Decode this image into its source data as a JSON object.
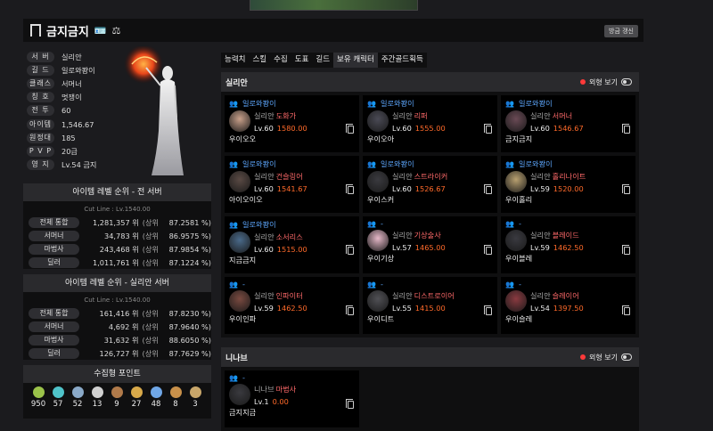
{
  "header": {
    "name": "금지금지",
    "refresh_label": "방금 갱신"
  },
  "profile": {
    "rows": [
      {
        "label": "서 버",
        "value": "실리안"
      },
      {
        "label": "길 드",
        "value": "일로와봥이"
      },
      {
        "label": "클래스",
        "value": "서머너"
      },
      {
        "label": "칭 호",
        "value": "멋쟁이"
      },
      {
        "label": "전 투",
        "value": "60"
      },
      {
        "label": "아이템",
        "value": "1,546.67"
      },
      {
        "label": "원정대",
        "value": "185"
      },
      {
        "label": "P V P",
        "value": "20급"
      },
      {
        "label": "영 지",
        "value": "Lv.54 금지"
      }
    ]
  },
  "rank_all": {
    "title": "아이템 레벨 순위 - 전 서버",
    "cut": "Cut Line : Lv.1540.00",
    "rows": [
      {
        "label": "전체 통합",
        "value": "1,281,357 위",
        "sub": "(상위",
        "pct": "87.2581 %)"
      },
      {
        "label": "서머너",
        "value": "34,783 위",
        "sub": "(상위",
        "pct": "86.9575 %)"
      },
      {
        "label": "마법사",
        "value": "243,468 위",
        "sub": "(상위",
        "pct": "87.9854 %)"
      },
      {
        "label": "딜러",
        "value": "1,011,761 위",
        "sub": "(상위",
        "pct": "87.1224 %)"
      }
    ]
  },
  "rank_server": {
    "title": "아이템 레벨 순위 - 실리안 서버",
    "cut": "Cut Line : Lv.1540.00",
    "rows": [
      {
        "label": "전체 통합",
        "value": "161,416 위",
        "sub": "(상위",
        "pct": "87.8230 %)"
      },
      {
        "label": "서머너",
        "value": "4,692 위",
        "sub": "(상위",
        "pct": "87.9640 %)"
      },
      {
        "label": "마법사",
        "value": "31,632 위",
        "sub": "(상위",
        "pct": "88.6050 %)"
      },
      {
        "label": "딜러",
        "value": "126,727 위",
        "sub": "(상위",
        "pct": "87.7629 %)"
      }
    ]
  },
  "collect": {
    "title": "수집형 포인트",
    "items": [
      {
        "icon": "mokoko-seed-icon",
        "color": "#9bc34a",
        "count": "950"
      },
      {
        "icon": "island-heart-icon",
        "color": "#4fc3c9",
        "count": "57"
      },
      {
        "icon": "giant-heart-icon",
        "color": "#8aa9c8",
        "count": "52"
      },
      {
        "icon": "art-icon",
        "color": "#d0d0d0",
        "count": "13"
      },
      {
        "icon": "omnium-star-icon",
        "color": "#b07a4a",
        "count": "9"
      },
      {
        "icon": "ignea-token-icon",
        "color": "#d8a94a",
        "count": "27"
      },
      {
        "icon": "orpheus-star-icon",
        "color": "#6fa6e6",
        "count": "48"
      },
      {
        "icon": "world-tree-leaf-icon",
        "color": "#c8904a",
        "count": "8"
      },
      {
        "icon": "sea-bounty-icon",
        "color": "#c8a66a",
        "count": "3"
      }
    ]
  },
  "tabs": [
    "능력치",
    "스킬",
    "수집",
    "도표",
    "길드",
    "보유 캐릭터",
    "주간골드획득"
  ],
  "active_tab": 5,
  "sections": [
    {
      "title": "실리안",
      "toggle_label": "외형 보기",
      "cards": [
        {
          "guild": "일로와봥이",
          "server": "실리안",
          "job": "도화가",
          "lv": "Lv.60",
          "il": "1580.00",
          "name": "우이오오",
          "color": "#c9a08a"
        },
        {
          "guild": "일로와봥이",
          "server": "실리안",
          "job": "리퍼",
          "lv": "Lv.60",
          "il": "1555.00",
          "name": "우이오아",
          "color": "#4a4a55"
        },
        {
          "guild": "일로와봥이",
          "server": "실리안",
          "job": "서머너",
          "lv": "Lv.60",
          "il": "1546.67",
          "name": "금지금지",
          "color": "#6a4a55"
        },
        {
          "guild": "일로와봥이",
          "server": "실리안",
          "job": "건슬링어",
          "lv": "Lv.60",
          "il": "1541.67",
          "name": "아이오이오",
          "color": "#5a4a44"
        },
        {
          "guild": "일로와봥이",
          "server": "실리안",
          "job": "스트라이커",
          "lv": "Lv.60",
          "il": "1526.67",
          "name": "우이스커",
          "color": "#3a3a3f"
        },
        {
          "guild": "일로와봥이",
          "server": "실리안",
          "job": "홀리나이트",
          "lv": "Lv.59",
          "il": "1520.00",
          "name": "우이홀리",
          "color": "#b8a070"
        },
        {
          "guild": "일로와봥이",
          "server": "실리안",
          "job": "소서리스",
          "lv": "Lv.60",
          "il": "1515.00",
          "name": "지금금지",
          "color": "#4a6a8a"
        },
        {
          "guild": "-",
          "server": "실리안",
          "job": "기상술사",
          "lv": "Lv.57",
          "il": "1465.00",
          "name": "우이기상",
          "color": "#e6b8c8"
        },
        {
          "guild": "-",
          "server": "실리안",
          "job": "블레이드",
          "lv": "Lv.59",
          "il": "1462.50",
          "name": "우이블레",
          "color": "#3a3a40"
        },
        {
          "guild": "-",
          "server": "실리안",
          "job": "인파이터",
          "lv": "Lv.59",
          "il": "1462.50",
          "name": "우이인파",
          "color": "#7a4a40"
        },
        {
          "guild": "-",
          "server": "실리안",
          "job": "디스트로이어",
          "lv": "Lv.55",
          "il": "1415.00",
          "name": "우이디트",
          "color": "#505055"
        },
        {
          "guild": "-",
          "server": "실리안",
          "job": "슬레이어",
          "lv": "Lv.54",
          "il": "1397.50",
          "name": "우이슬레",
          "color": "#8a3a40"
        }
      ]
    },
    {
      "title": "니나브",
      "toggle_label": "외형 보기",
      "cards": [
        {
          "guild": "-",
          "server": "니나브",
          "job": "마법사",
          "lv": "Lv.1",
          "il": "0.00",
          "name": "금지지금",
          "color": "#3a3a3f"
        }
      ]
    }
  ]
}
